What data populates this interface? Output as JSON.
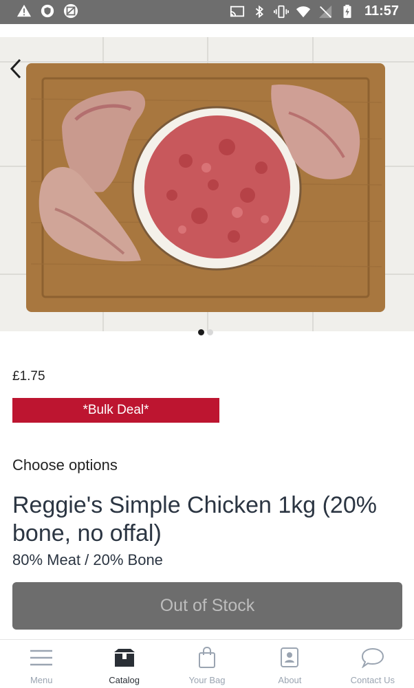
{
  "status_bar": {
    "time": "11:57",
    "left_icons": [
      "warning-icon",
      "shield-icon",
      "image-icon"
    ],
    "right_icons": [
      "cast-icon",
      "bluetooth-icon",
      "vibrate-icon",
      "wifi-icon",
      "no-signal-icon",
      "battery-charging-icon"
    ]
  },
  "product": {
    "carousel": {
      "slide_count": 2,
      "active_index": 0
    },
    "price": "£1.75",
    "badge": "*Bulk Deal*",
    "options_heading": "Choose options",
    "title": "Reggie's Simple Chicken 1kg (20% bone, no offal)",
    "subtitle": "80% Meat / 20% Bone",
    "stock_button": "Out of Stock"
  },
  "colors": {
    "badge": "#bd1530",
    "stock_button": "#6d6d6d",
    "title_text": "#2b3542",
    "nav_inactive": "#9aa4b1"
  },
  "bottom_nav": {
    "items": [
      {
        "label": "Menu",
        "icon": "menu-icon",
        "active": false
      },
      {
        "label": "Catalog",
        "icon": "catalog-box-icon",
        "active": true
      },
      {
        "label": "Your Bag",
        "icon": "shopping-bag-icon",
        "active": false
      },
      {
        "label": "About",
        "icon": "about-contact-card-icon",
        "active": false
      },
      {
        "label": "Contact Us",
        "icon": "chat-bubble-icon",
        "active": false
      }
    ]
  }
}
